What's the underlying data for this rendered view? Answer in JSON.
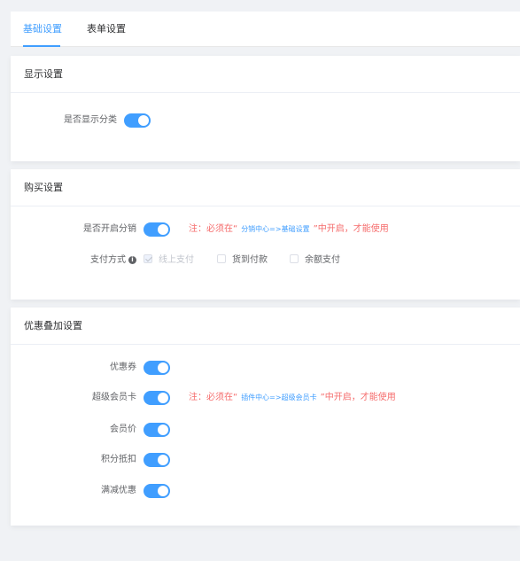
{
  "tabs": [
    {
      "label": "基础设置",
      "active": true
    },
    {
      "label": "表单设置",
      "active": false
    }
  ],
  "display_section": {
    "title": "显示设置",
    "show_category": {
      "label": "是否显示分类",
      "enabled": true
    }
  },
  "purchase_section": {
    "title": "购买设置",
    "distribution": {
      "label": "是否开启分销",
      "enabled": true,
      "note_prefix": "注：必须在“",
      "note_link": "分销中心=>基础设置",
      "note_suffix": "”中开启，才能使用"
    },
    "payment": {
      "label": "支付方式",
      "options": [
        {
          "label": "线上支付",
          "checked": true,
          "disabled": true
        },
        {
          "label": "货到付款",
          "checked": false,
          "disabled": false
        },
        {
          "label": "余额支付",
          "checked": false,
          "disabled": false
        }
      ]
    }
  },
  "discount_section": {
    "title": "优惠叠加设置",
    "coupon": {
      "label": "优惠券",
      "enabled": true
    },
    "super_card": {
      "label": "超级会员卡",
      "enabled": true,
      "note_prefix": "注：必须在“",
      "note_link": "插件中心=>超级会员卡",
      "note_suffix": "”中开启，才能使用"
    },
    "member_price": {
      "label": "会员价",
      "enabled": true
    },
    "points": {
      "label": "积分抵扣",
      "enabled": true
    },
    "full_reduction": {
      "label": "满减优惠",
      "enabled": true
    }
  },
  "colors": {
    "accent": "#409eff",
    "warning_text": "#f56c6c"
  },
  "icons": {
    "payment_info": "info-icon"
  }
}
